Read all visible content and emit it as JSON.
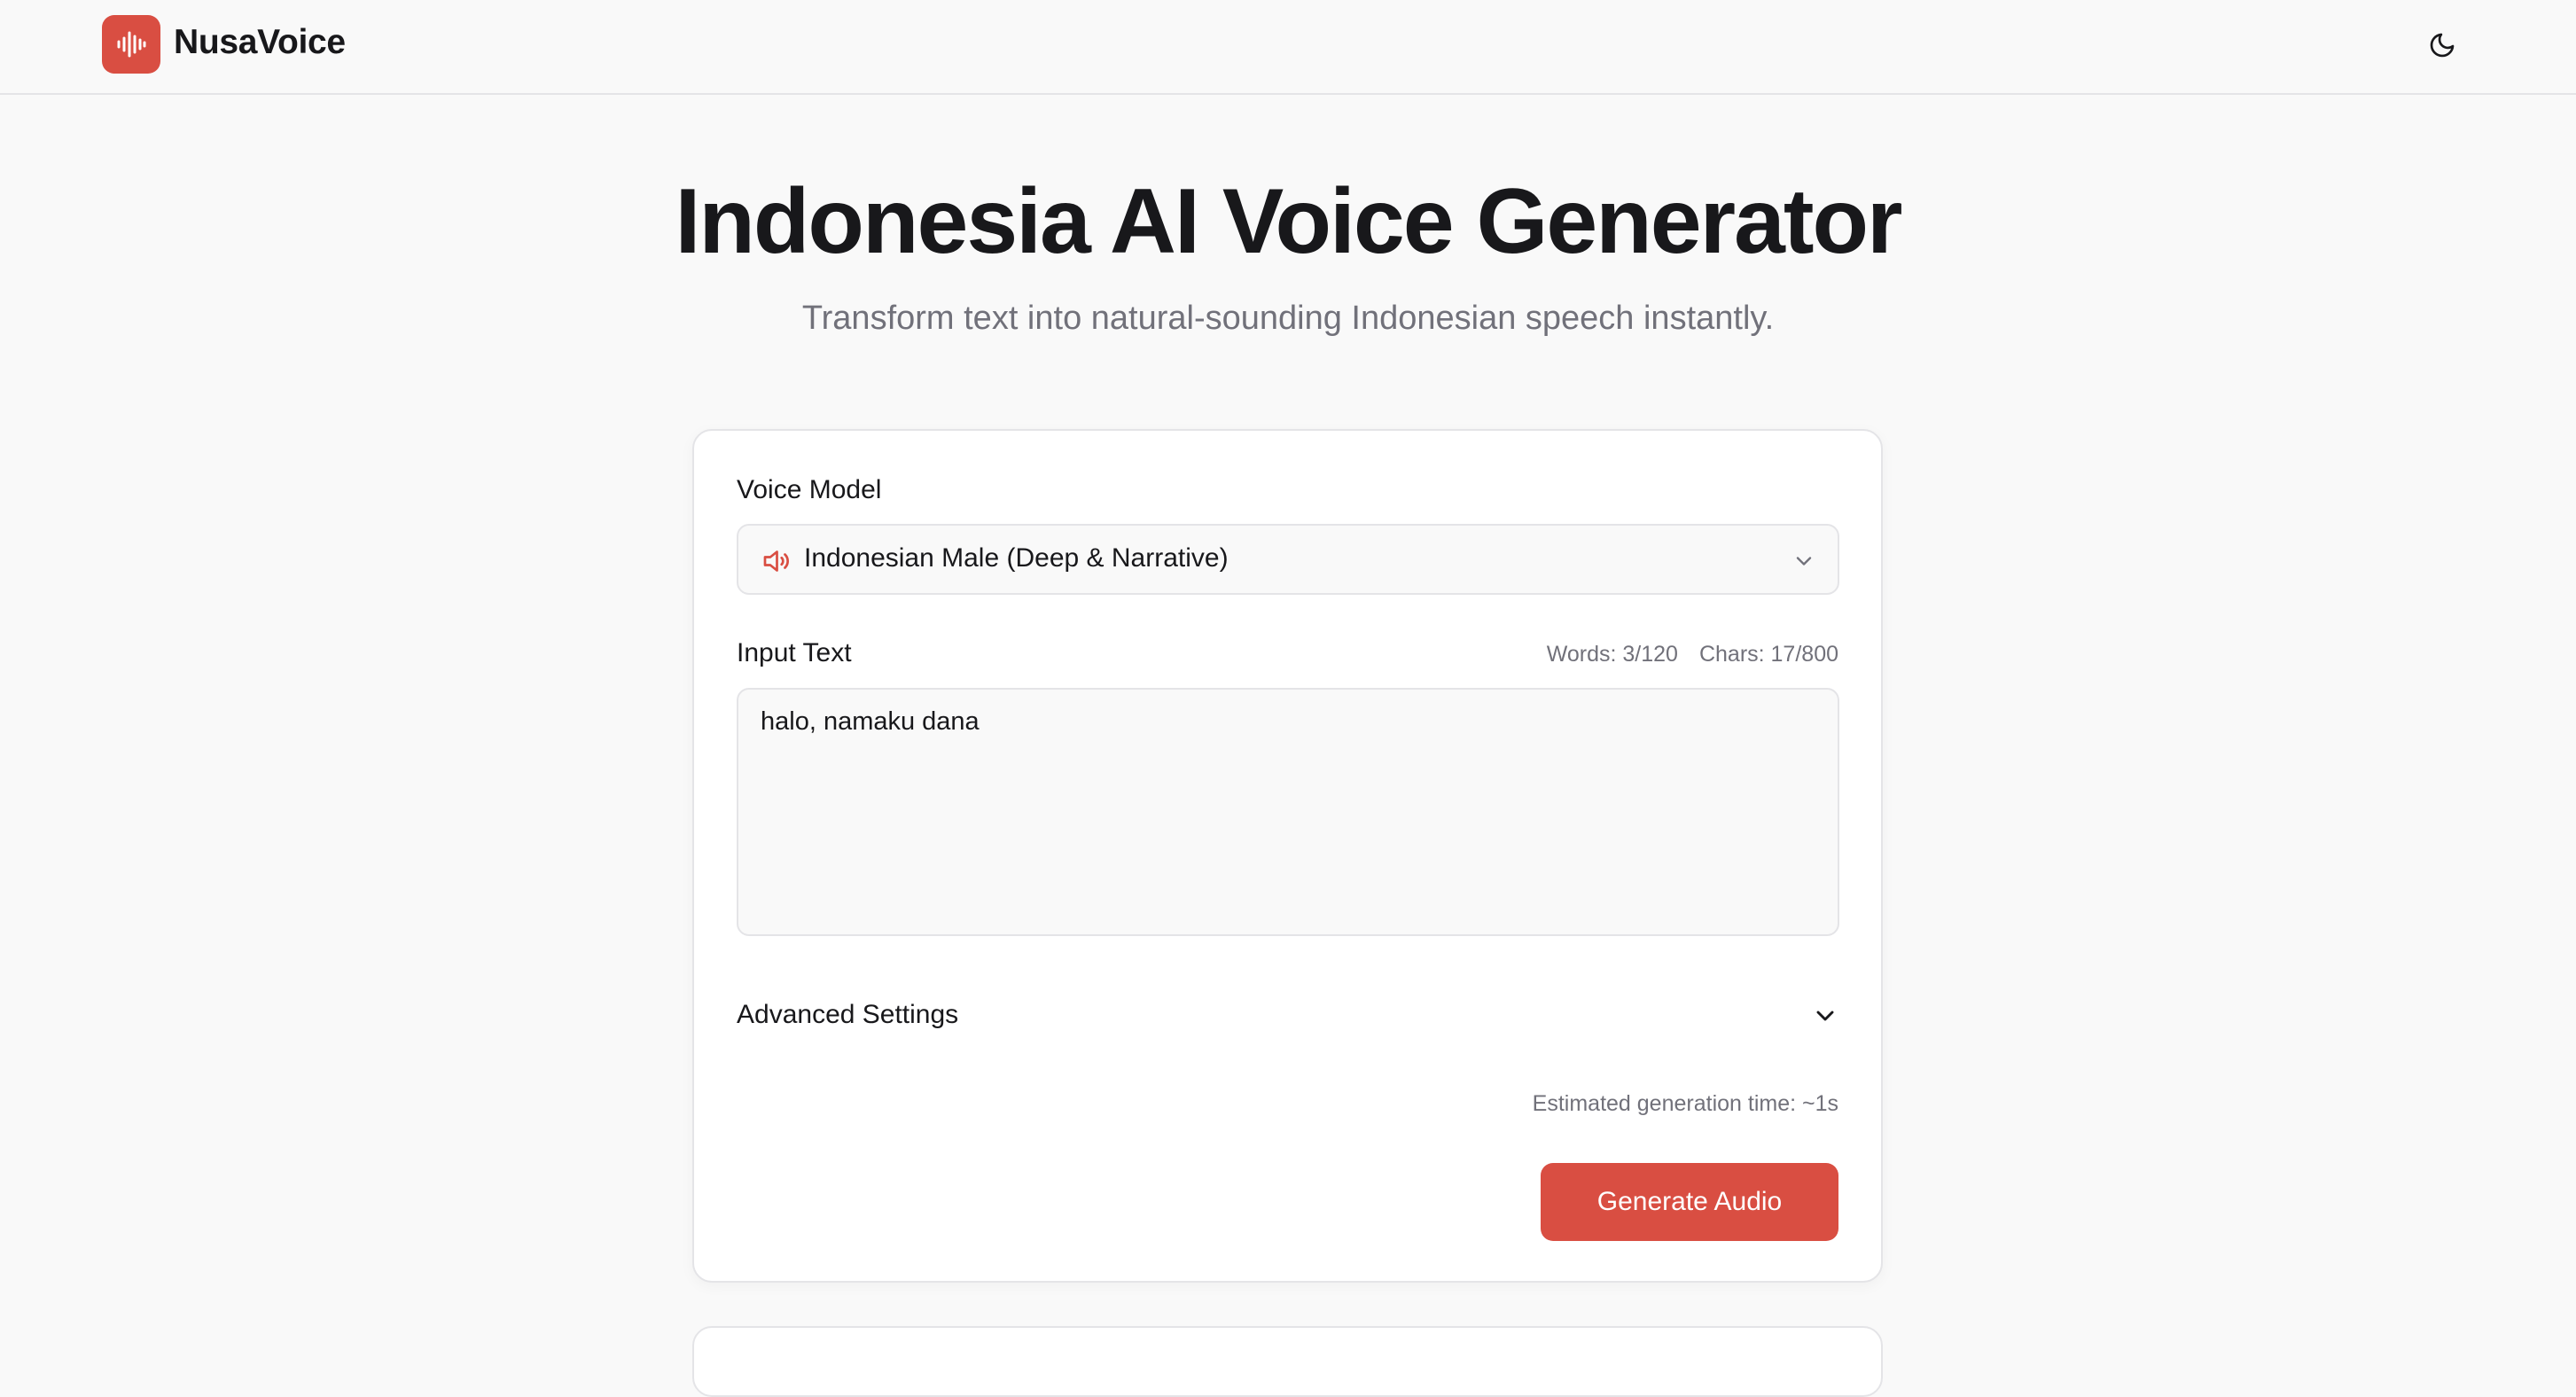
{
  "app": {
    "brand": "NusaVoice",
    "accent_color": "#d94e42",
    "icons": {
      "logo": "sound-wave-icon",
      "theme": "moon-icon"
    }
  },
  "hero": {
    "title": "Indonesia AI Voice Generator",
    "subtitle": "Transform text into natural-sounding Indonesian speech instantly."
  },
  "form": {
    "voice_model_label": "Voice Model",
    "voice_model_value": "Indonesian Male (Deep & Narrative)",
    "input_text_label": "Input Text",
    "words_counter": "Words: 3/120",
    "chars_counter": "Chars: 17/800",
    "input_text_value": "halo, namaku dana",
    "advanced_settings_label": "Advanced Settings",
    "estimated_time": "Estimated generation time: ~1s",
    "generate_label": "Generate Audio"
  }
}
